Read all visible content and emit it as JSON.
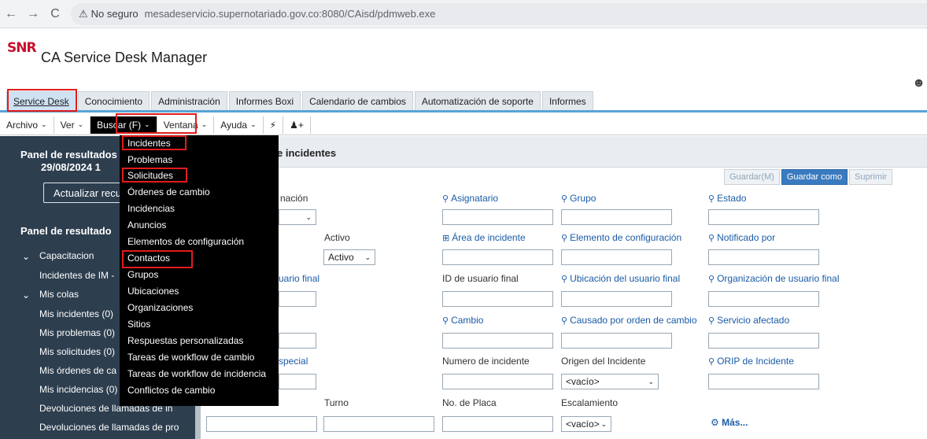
{
  "browser": {
    "back": "←",
    "forward": "→",
    "reload": "C",
    "security_label": "No seguro",
    "url": "mesadeservicio.supernotariado.gov.co:8080/CAisd/pdmweb.exe"
  },
  "app": {
    "logo": "SNR",
    "title": "CA Service Desk Manager",
    "user_icon": "person-icon"
  },
  "tabs": [
    "Service Desk",
    "Conocimiento",
    "Administración",
    "Informes Boxi",
    "Calendario de cambios",
    "Automatización de soporte",
    "Informes"
  ],
  "menubar": {
    "items": [
      "Archivo",
      "Ver",
      "Buscar (F)",
      "Ventana",
      "Ayuda"
    ]
  },
  "left_panel": {
    "title": "Panel de resultados",
    "date": "29/08/2024 1",
    "update_button": "Actualizar recu",
    "title2": "Panel de resultado",
    "items": [
      "Capacitacion",
      "Incidentes de IM -",
      "Mis colas",
      "Mis incidentes (0)",
      "Mis problemas (0)",
      "Mis solicitudes (0)",
      "Mis órdenes de ca",
      "Mis incidencias (0)",
      "Devoluciones de llamadas de in",
      "Devoluciones de llamadas de pro"
    ]
  },
  "results": {
    "title": "e incidentes",
    "buttons": [
      "Guardar(M)",
      "Guardar como",
      "Suprimir"
    ]
  },
  "form": {
    "labels": {
      "ordenacion": "nación",
      "asignatario": "Asignatario",
      "grupo": "Grupo",
      "estado": "Estado",
      "activo": "Activo",
      "area": "Área de incidente",
      "elemento": "Elemento de configuración",
      "notificado": "Notificado por",
      "usuario_final": "uario final",
      "id_usuario": "ID de usuario final",
      "ubicacion": "Ubicación del usuario final",
      "organizacion": "Organización de usuario final",
      "cambio": "Cambio",
      "causado": "Causado por orden de cambio",
      "servicio": "Servicio afectado",
      "especial": "special",
      "numero": "Numero de incidente",
      "origen": "Origen del Incidente",
      "orip": "ORIP de Incidente",
      "turno": "Turno",
      "placa": "No. de Placa",
      "escalamiento": "Escalamiento"
    },
    "activo_value": "Activo",
    "origen_value": "<vacío>",
    "escalamiento_value": "<vacío>",
    "mas": "Más..."
  },
  "dropdown": {
    "items": [
      "Incidentes",
      "Problemas",
      "Solicitudes",
      "Órdenes de cambio",
      "Incidencias",
      "Anuncios",
      "Elementos de configuración",
      "Contactos",
      "Grupos",
      "Ubicaciones",
      "Organizaciones",
      "Sitios",
      "Respuestas personalizadas",
      "Tareas de workflow de cambio",
      "Tareas de workflow de incidencia",
      "Conflictos de cambio"
    ]
  }
}
